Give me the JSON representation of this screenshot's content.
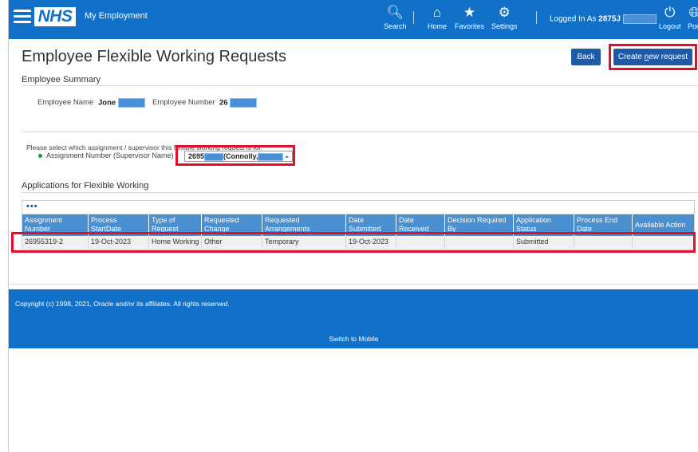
{
  "header": {
    "brand": "NHS",
    "app_title": "My Employment",
    "search": "Search",
    "home": "Home",
    "favorites": "Favorites",
    "settings": "Settings",
    "logged_in_prefix": "Logged In As",
    "logged_in_user": "2875J",
    "logout": "Logout",
    "portal": "Port"
  },
  "page": {
    "title": "Employee Flexible Working Requests",
    "back": "Back",
    "create_pre": "Create ",
    "create_u": "n",
    "create_post": "ew request"
  },
  "summary": {
    "title": "Employee Summary",
    "name_label": "Employee Name",
    "name_value": "Jone",
    "number_label": "Employee Number",
    "number_value": "26"
  },
  "assignment": {
    "instruction": "Please select which assignment / supervisor this flexible working request is for.",
    "label": "Assignment Number (Supervisor Name)",
    "select_prefix": "2695",
    "select_middle": "(Connolly,",
    "chevron": "⌄"
  },
  "applications": {
    "title": "Applications for Flexible Working",
    "toolbar": "•••",
    "columns": [
      "Assignment Number",
      "Process StartDate",
      "Type of Request",
      "Requested Change",
      "Requested Arrangements",
      "Date Submitted",
      "Date Received",
      "Decision Required By",
      "Application Status",
      "Process End Date",
      "Available Action"
    ],
    "rows": [
      [
        "26955319-2",
        "19-Oct-2023",
        "Home Working",
        "Other",
        "Temporary",
        "19-Oct-2023",
        "",
        "",
        "Submitted",
        "",
        ""
      ]
    ]
  },
  "footer": {
    "copyright": "Copyright (c) 1998, 2021, Oracle and/or its affiliates. All rights reserved.",
    "switch_mobile": "Switch to Mobile"
  },
  "colors": {
    "header_blue": "#1170c8",
    "button_blue": "#1e5aa8",
    "table_header": "#4a8fd0",
    "highlight_red": "#e0102a"
  }
}
